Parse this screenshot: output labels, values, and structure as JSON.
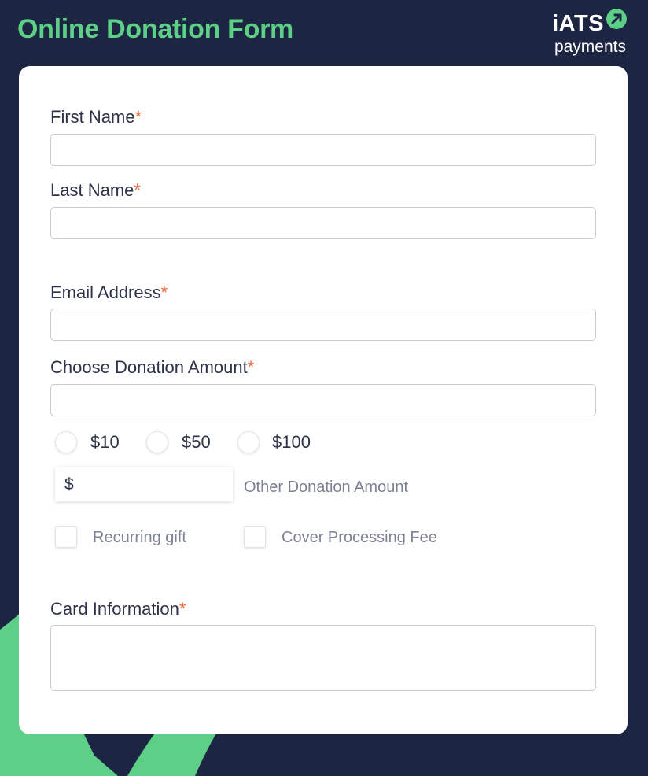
{
  "header": {
    "title": "Online Donation Form",
    "logo": {
      "word": "iATS",
      "subword": "payments",
      "mark_icon": "arrow-up-right-icon"
    }
  },
  "colors": {
    "background": "#1c2541",
    "accent_green": "#5ecf86",
    "required_asterisk": "#e8633a",
    "card": "#ffffff"
  },
  "form": {
    "required_marker": "*",
    "first_name": {
      "label": "First Name",
      "value": ""
    },
    "last_name": {
      "label": "Last Name",
      "value": ""
    },
    "email": {
      "label": "Email Address",
      "value": ""
    },
    "donation_amount": {
      "label": "Choose Donation Amount",
      "value": ""
    },
    "preset_amounts": [
      "$10",
      "$50",
      "$100"
    ],
    "other_amount": {
      "currency_symbol": "$",
      "label": "Other Donation Amount",
      "value": ""
    },
    "options": {
      "recurring_gift": "Recurring gift",
      "cover_fee": "Cover Processing Fee"
    },
    "card_information": {
      "label": "Card Information",
      "value": ""
    }
  }
}
